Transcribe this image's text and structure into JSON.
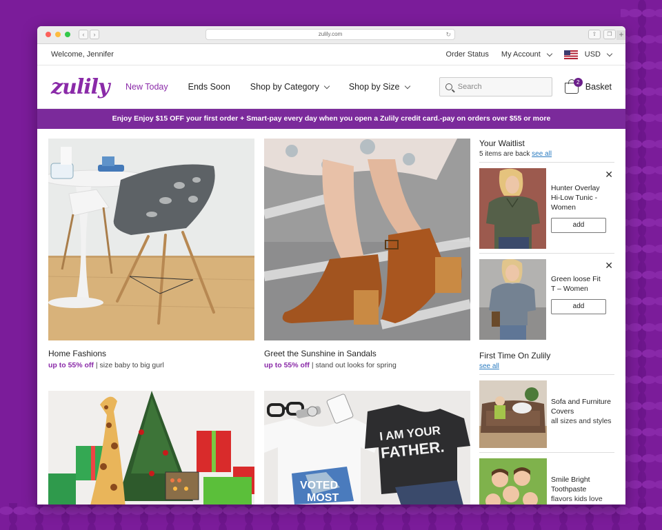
{
  "browser": {
    "url": "zulily.com"
  },
  "topbar": {
    "welcome": "Welcome, Jennifer",
    "order_status": "Order Status",
    "my_account": "My Account",
    "currency": "USD"
  },
  "header": {
    "logo": "zulily",
    "nav": [
      "New Today",
      "Ends Soon",
      "Shop by Category",
      "Shop by Size"
    ],
    "search_placeholder": "Search",
    "basket_label": "Basket",
    "basket_count": "2"
  },
  "promo": {
    "text": "Enjoy Enjoy $15 OFF your first order + Smart-pay every day when you open a Zulily credit card.-pay on orders over $55 or more"
  },
  "events": [
    {
      "title": "Home Fashions",
      "deal": "up to 55% off",
      "desc": " | size baby to big gurl"
    },
    {
      "title": "Greet the Sunshine in Sandals",
      "deal": "up to 55% off",
      "desc": " | stand out looks for spring"
    },
    {
      "title": "",
      "deal": "",
      "desc": ""
    },
    {
      "title": "",
      "deal": "",
      "desc": ""
    }
  ],
  "waitlist": {
    "title": "Your Waitlist",
    "meta": "5 items are back ",
    "see_all": "see all",
    "items": [
      {
        "name": "Hunter Overlay Hi-Low Tunic - Women",
        "add": "add"
      },
      {
        "name": "Green loose Fit T – Women",
        "add": "add"
      }
    ]
  },
  "first_time": {
    "title": "First Time On Zulily",
    "see_all": "see all",
    "items": [
      {
        "name": "Sofa and Furniture Covers",
        "detail": "all sizes and styles"
      },
      {
        "name": "Smile Bright Toothpaste",
        "detail": "flavors kids love"
      }
    ]
  },
  "colors": {
    "brand_purple": "#8a2aa8",
    "promo_bg": "#7b2a9b",
    "link_blue": "#2a7bc0"
  }
}
